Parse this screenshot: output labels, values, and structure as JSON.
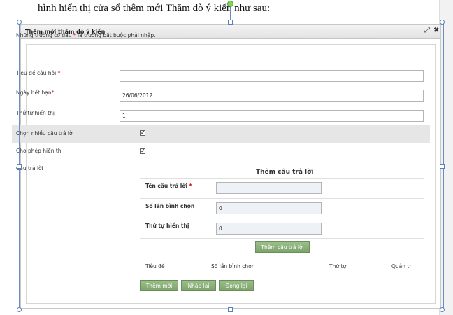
{
  "document": {
    "caption": "hình hiển thị cửa sổ thêm mới Thăm  dò ý kiến như sau:"
  },
  "dialog": {
    "title": "Thêm mới thăm dò ý kiến",
    "maximize_icon": "expand-icon",
    "close_icon": "close-icon"
  },
  "form": {
    "note_prefix": "Những trường có dấu",
    "note_star": "*",
    "note_suffix": "là trường bắt buộc phải nhập.",
    "question_label": "Tiêu đề câu hỏi",
    "question_value": "",
    "expiry_label": "Ngày hết hạn",
    "expiry_value": "26/06/2012",
    "order_label": "Thứ tự hiển thị",
    "order_value": "1",
    "multi_label": "Chọn nhiều câu trả lời",
    "multi_checked": true,
    "show_label": "Cho phép hiển thị",
    "show_checked": true,
    "answers_label": "Câu trả lời",
    "required_star": "*"
  },
  "answer_form": {
    "title": "Thêm câu trả lời",
    "name_label": "Tên câu trả lời",
    "name_value": "",
    "votes_label": "Số lần bình chọn",
    "votes_value": "0",
    "order_label": "Thứ tự hiển thị",
    "order_value": "0",
    "add_button": "Thêm câu trả lời"
  },
  "answer_table": {
    "columns": [
      "Tiêu đề",
      "Số lần bình chọn",
      "Thứ tự",
      "Quản trị"
    ]
  },
  "actions": {
    "add_new": "Thêm mới",
    "reset": "Nhập lại",
    "close": "Đóng lại"
  },
  "colors": {
    "button_green": "#7ea36c",
    "selection_blue": "#6b8cc9",
    "required_red": "#cc0000"
  }
}
